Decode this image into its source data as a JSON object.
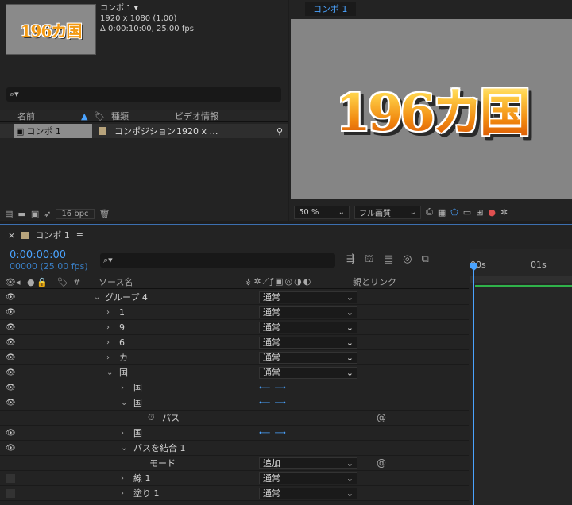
{
  "project": {
    "thumbnail_text": "196カ国",
    "comp_name": "コンポ 1 ▾",
    "comp_resolution": "1920 x 1080 (1.00)",
    "comp_duration": "Δ 0:00:10:00, 25.00 fps",
    "search_icon": "⌕▾",
    "columns": {
      "name": "名前",
      "type": "種類",
      "video_info": "ビデオ情報"
    },
    "item": {
      "name": "コンポ 1",
      "type": "コンポジション",
      "video_info": "1920 x …"
    },
    "bpc": "16 bpc"
  },
  "viewer": {
    "tab": "コンポ 1",
    "canvas_text": "196カ国",
    "zoom": "50 %",
    "quality": "フル画質"
  },
  "timeline": {
    "tab": "コンポ 1",
    "timecode": "0:00:00:00",
    "frames": "00000 (25.00 fps)",
    "search_icon": "⌕▾",
    "columns": {
      "num": "#",
      "source": "ソース名",
      "parent": "親とリンク"
    },
    "ruler": [
      "00s",
      "01s"
    ],
    "rows": [
      {
        "label": "グループ 4",
        "chev": "⌄",
        "mode": "通常"
      },
      {
        "label": "1",
        "chev": "›",
        "mode": "通常"
      },
      {
        "label": "9",
        "chev": "›",
        "mode": "通常"
      },
      {
        "label": "6",
        "chev": "›",
        "mode": "通常"
      },
      {
        "label": "カ",
        "chev": "›",
        "mode": "通常"
      },
      {
        "label": "国",
        "chev": "⌄",
        "mode": "通常"
      },
      {
        "label": "国",
        "chev": "›",
        "mode": ""
      },
      {
        "label": "国",
        "chev": "⌄",
        "mode": ""
      },
      {
        "label": "パス",
        "chev": "",
        "mode": ""
      },
      {
        "label": "国",
        "chev": "›",
        "mode": ""
      },
      {
        "label": "パスを結合 1",
        "chev": "⌄",
        "mode": ""
      },
      {
        "label": "モード",
        "chev": "",
        "mode": "追加"
      },
      {
        "label": "線 1",
        "chev": "›",
        "mode": "通常"
      },
      {
        "label": "塗り 1",
        "chev": "›",
        "mode": "通常"
      }
    ]
  }
}
